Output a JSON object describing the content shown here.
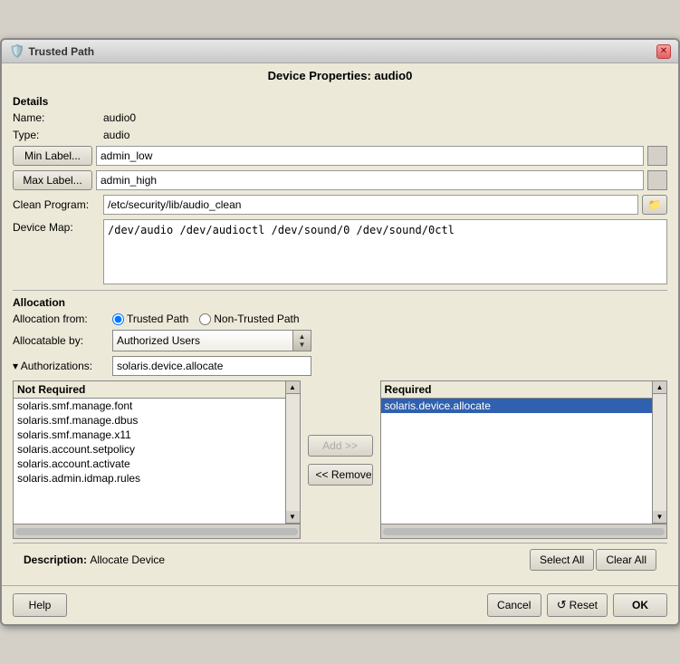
{
  "titlebar": {
    "title": "Trusted Path",
    "icon": "🛡️",
    "close_label": "✕"
  },
  "window_title": "Device Properties: audio0",
  "details": {
    "section_label": "Details",
    "name_label": "Name:",
    "name_value": "audio0",
    "type_label": "Type:",
    "type_value": "audio",
    "min_label_btn": "Min Label...",
    "min_label_value": "admin_low",
    "max_label_btn": "Max Label...",
    "max_label_value": "admin_high",
    "clean_program_label": "Clean Program:",
    "clean_program_value": "/etc/security/lib/audio_clean",
    "device_map_label": "Device Map:",
    "device_map_value": "/dev/audio /dev/audioctl /dev/sound/0 /dev/sound/0ctl"
  },
  "allocation": {
    "section_label": "Allocation",
    "allocation_from_label": "Allocation from:",
    "trusted_path_label": "Trusted Path",
    "non_trusted_path_label": "Non-Trusted Path",
    "allocatable_by_label": "Allocatable by:",
    "allocatable_by_value": "Authorized Users",
    "authorizations_label": "▾ Authorizations:",
    "authorizations_value": "solaris.device.allocate",
    "not_required_header": "Not Required",
    "required_header": "Required",
    "not_required_items": [
      "solaris.smf.manage.font",
      "solaris.smf.manage.dbus",
      "solaris.smf.manage.x11",
      "solaris.account.setpolicy",
      "solaris.account.activate",
      "solaris.admin.idmap.rules"
    ],
    "required_items": [
      "solaris.device.allocate"
    ],
    "required_selected": "solaris.device.allocate",
    "add_btn": "Add >>",
    "remove_btn": "<< Remove",
    "description_label": "Description:",
    "description_value": "Allocate Device",
    "select_all_btn": "Select All",
    "clear_all_btn": "Clear All"
  },
  "footer": {
    "help_btn": "Help",
    "cancel_btn": "Cancel",
    "reset_btn": "Reset",
    "ok_btn": "OK"
  }
}
